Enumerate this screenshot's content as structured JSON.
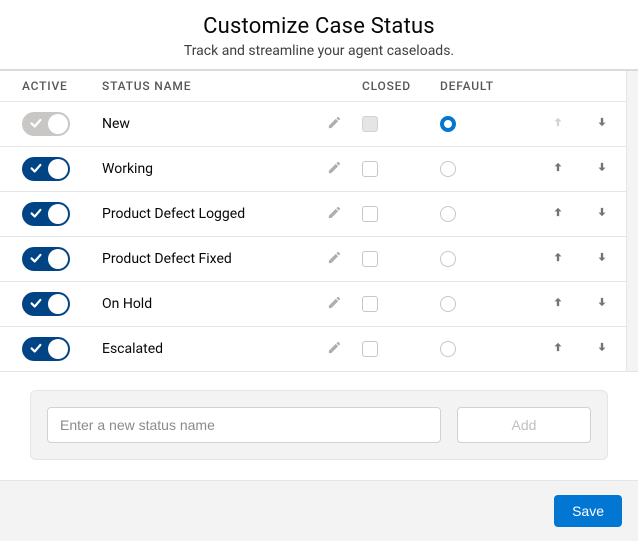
{
  "header": {
    "title": "Customize Case Status",
    "subtitle": "Track and streamline your agent caseloads."
  },
  "columns": {
    "active": "ACTIVE",
    "status_name": "STATUS NAME",
    "closed": "CLOSED",
    "default": "DEFAULT"
  },
  "rows": [
    {
      "name": "New",
      "active": true,
      "active_locked": true,
      "closed_locked": true,
      "default_selected": true,
      "can_move_up": false,
      "can_move_down": true
    },
    {
      "name": "Working",
      "active": true,
      "active_locked": false,
      "closed_locked": false,
      "default_selected": false,
      "can_move_up": true,
      "can_move_down": true
    },
    {
      "name": "Product Defect Logged",
      "active": true,
      "active_locked": false,
      "closed_locked": false,
      "default_selected": false,
      "can_move_up": true,
      "can_move_down": true
    },
    {
      "name": "Product Defect Fixed",
      "active": true,
      "active_locked": false,
      "closed_locked": false,
      "default_selected": false,
      "can_move_up": true,
      "can_move_down": true
    },
    {
      "name": "On Hold",
      "active": true,
      "active_locked": false,
      "closed_locked": false,
      "default_selected": false,
      "can_move_up": true,
      "can_move_down": true
    },
    {
      "name": "Escalated",
      "active": true,
      "active_locked": false,
      "closed_locked": false,
      "default_selected": false,
      "can_move_up": true,
      "can_move_down": true
    }
  ],
  "add": {
    "placeholder": "Enter a new status name",
    "button_label": "Add"
  },
  "footer": {
    "save_label": "Save"
  }
}
